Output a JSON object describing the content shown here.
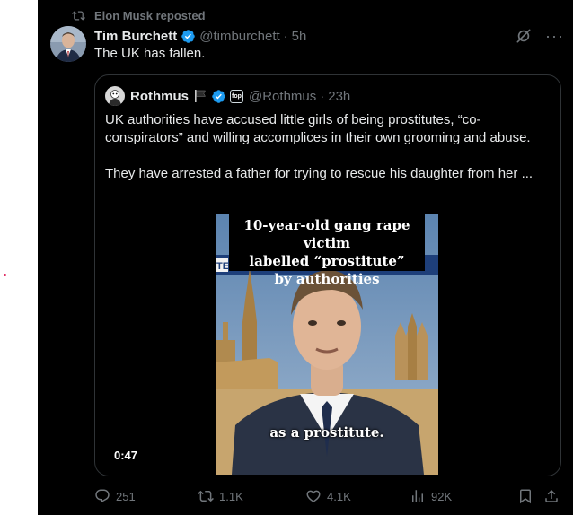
{
  "repost": {
    "label": "Elon Musk reposted"
  },
  "post": {
    "author_name": "Tim Burchett",
    "handle": "@timburchett",
    "time": "5h",
    "separator": "·",
    "text": "The UK has fallen."
  },
  "quote": {
    "author_name": "Rothmus",
    "badge_text": "fop",
    "handle": "@Rothmus",
    "separator": "·",
    "time": "23h",
    "paragraph1": "UK authorities have accused little girls of being prostitutes, “co-conspirators” and willing accomplices in their own grooming and abuse.",
    "paragraph2": "They have arrested a father for trying to rescue his daughter from her ...",
    "video": {
      "caption_top": [
        "10-year-old gang rape victim",
        "labelled “prostitute”",
        "by authorities"
      ],
      "caption_bottom": "as a prostitute.",
      "duration": "0:47",
      "banner_fragment": "TE"
    }
  },
  "actions": {
    "replies": "251",
    "reposts": "1.1K",
    "likes": "4.1K",
    "views": "92K"
  },
  "colors": {
    "background": "#000000",
    "text_primary": "#e7e9ea",
    "text_secondary": "#71767b",
    "border": "#2f3336",
    "verified_blue": "#1d9bf0"
  }
}
